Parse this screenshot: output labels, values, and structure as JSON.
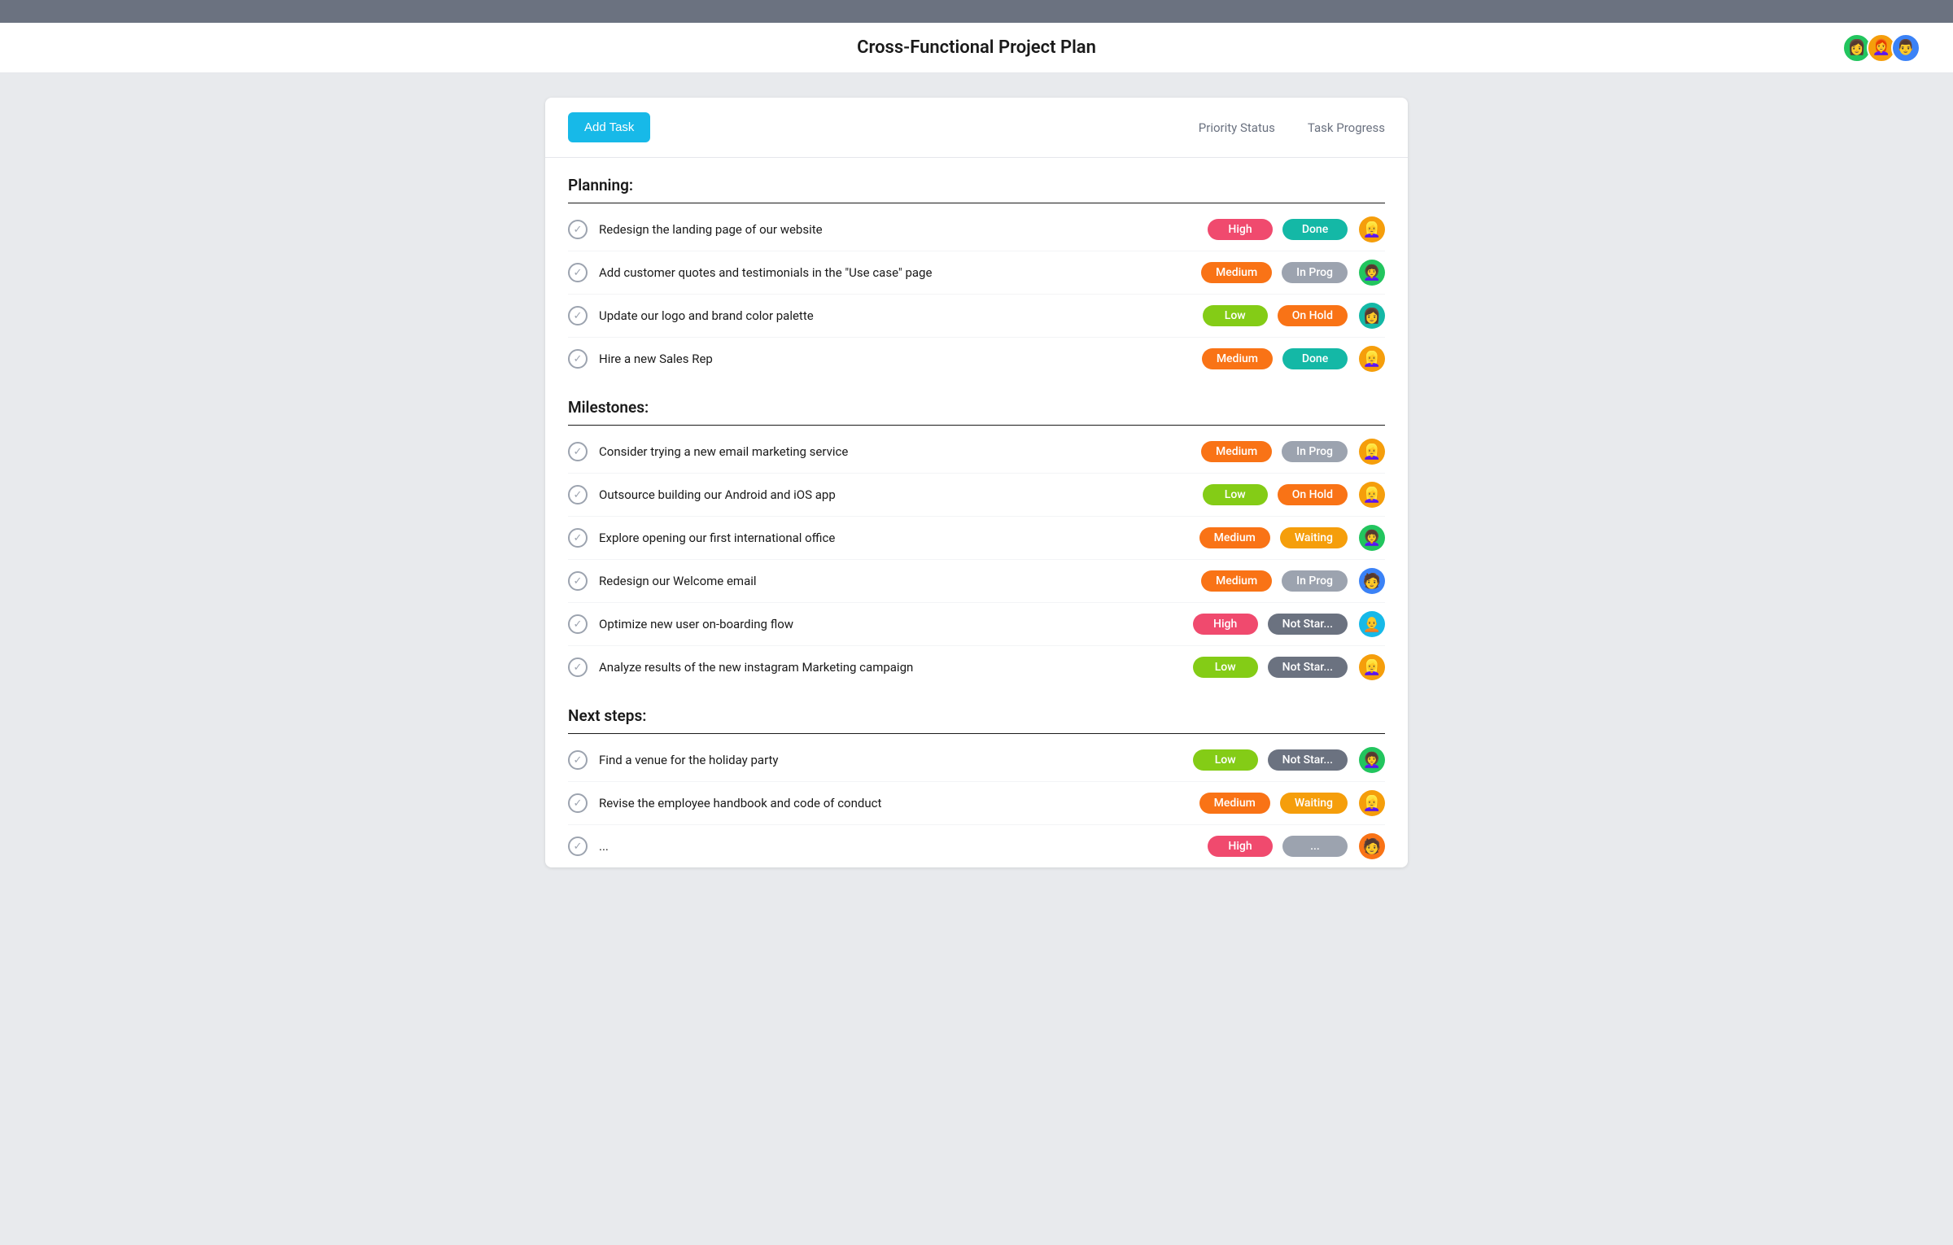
{
  "topBar": {},
  "header": {
    "title": "Cross-Functional Project Plan",
    "avatars": [
      {
        "id": "av1",
        "emoji": "👩",
        "color": "#22c55e"
      },
      {
        "id": "av2",
        "emoji": "👩‍🦰",
        "color": "#f59e0b"
      },
      {
        "id": "av3",
        "emoji": "👨",
        "color": "#3b82f6"
      }
    ]
  },
  "toolbar": {
    "addTaskLabel": "Add Task",
    "priorityLabel": "Priority Status",
    "progressLabel": "Task Progress"
  },
  "sections": [
    {
      "id": "planning",
      "title": "Planning:",
      "tasks": [
        {
          "id": "t1",
          "name": "Redesign the landing page of our website",
          "priority": "High",
          "priorityClass": "badge-high",
          "status": "Done",
          "statusClass": "badge-done",
          "avatar": "👱‍♀️",
          "avatarColor": "#f59e0b"
        },
        {
          "id": "t2",
          "name": "Add customer quotes and testimonials in the \"Use case\" page",
          "priority": "Medium",
          "priorityClass": "badge-medium",
          "status": "In Prog",
          "statusClass": "badge-in-prog",
          "avatar": "👩‍🦱",
          "avatarColor": "#22c55e"
        },
        {
          "id": "t3",
          "name": "Update our logo and brand color palette",
          "priority": "Low",
          "priorityClass": "badge-low",
          "status": "On Hold",
          "statusClass": "badge-on-hold",
          "avatar": "👩",
          "avatarColor": "#14b8a6"
        },
        {
          "id": "t4",
          "name": "Hire a new Sales Rep",
          "priority": "Medium",
          "priorityClass": "badge-medium",
          "status": "Done",
          "statusClass": "badge-done",
          "avatar": "👱‍♀️",
          "avatarColor": "#f59e0b"
        }
      ]
    },
    {
      "id": "milestones",
      "title": "Milestones:",
      "tasks": [
        {
          "id": "t5",
          "name": "Consider trying a new email marketing service",
          "priority": "Medium",
          "priorityClass": "badge-medium",
          "status": "In Prog",
          "statusClass": "badge-in-prog",
          "avatar": "👱‍♀️",
          "avatarColor": "#f59e0b"
        },
        {
          "id": "t6",
          "name": "Outsource building our Android and iOS app",
          "priority": "Low",
          "priorityClass": "badge-low",
          "status": "On Hold",
          "statusClass": "badge-on-hold",
          "avatar": "👱‍♀️",
          "avatarColor": "#f59e0b"
        },
        {
          "id": "t7",
          "name": "Explore opening our first international office",
          "priority": "Medium",
          "priorityClass": "badge-medium",
          "status": "Waiting",
          "statusClass": "badge-waiting",
          "avatar": "👩‍🦱",
          "avatarColor": "#22c55e"
        },
        {
          "id": "t8",
          "name": "Redesign our Welcome email",
          "priority": "Medium",
          "priorityClass": "badge-medium",
          "status": "In Prog",
          "statusClass": "badge-in-prog",
          "avatar": "🧑",
          "avatarColor": "#3b82f6"
        },
        {
          "id": "t9",
          "name": "Optimize new user on-boarding flow",
          "priority": "High",
          "priorityClass": "badge-high",
          "status": "Not Star...",
          "statusClass": "badge-not-star",
          "avatar": "🧑‍🦲",
          "avatarColor": "#17b9e8"
        },
        {
          "id": "t10",
          "name": "Analyze results of the new instagram Marketing campaign",
          "priority": "Low",
          "priorityClass": "badge-low",
          "status": "Not Star...",
          "statusClass": "badge-not-star",
          "avatar": "👱‍♀️",
          "avatarColor": "#f59e0b"
        }
      ]
    },
    {
      "id": "next-steps",
      "title": "Next steps:",
      "tasks": [
        {
          "id": "t11",
          "name": "Find a venue for the holiday party",
          "priority": "Low",
          "priorityClass": "badge-low",
          "status": "Not Star...",
          "statusClass": "badge-not-star",
          "avatar": "👩‍🦱",
          "avatarColor": "#22c55e"
        },
        {
          "id": "t12",
          "name": "Revise the employee handbook and code of conduct",
          "priority": "Medium",
          "priorityClass": "badge-medium",
          "status": "Waiting",
          "statusClass": "badge-waiting",
          "avatar": "👱‍♀️",
          "avatarColor": "#f59e0b"
        },
        {
          "id": "t13",
          "name": "...",
          "priority": "High",
          "priorityClass": "badge-high",
          "status": "...",
          "statusClass": "badge-in-prog",
          "avatar": "🧑",
          "avatarColor": "#f97316"
        }
      ]
    }
  ]
}
